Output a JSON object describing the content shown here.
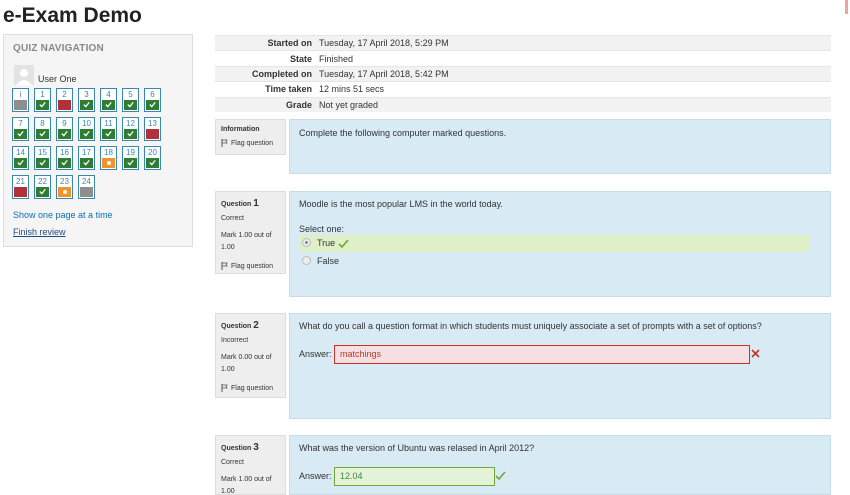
{
  "page": {
    "title": "e-Exam Demo"
  },
  "nav": {
    "heading": "QUIZ NAVIGATION",
    "user_name": "User One",
    "buttons": [
      {
        "label": "i",
        "state": "info"
      },
      {
        "label": "1",
        "state": "correct"
      },
      {
        "label": "2",
        "state": "incorrect"
      },
      {
        "label": "3",
        "state": "correct"
      },
      {
        "label": "4",
        "state": "correct"
      },
      {
        "label": "5",
        "state": "correct"
      },
      {
        "label": "6",
        "state": "correct"
      },
      {
        "label": "7",
        "state": "correct"
      },
      {
        "label": "8",
        "state": "correct"
      },
      {
        "label": "9",
        "state": "correct"
      },
      {
        "label": "10",
        "state": "correct"
      },
      {
        "label": "11",
        "state": "correct"
      },
      {
        "label": "12",
        "state": "correct"
      },
      {
        "label": "13",
        "state": "incorrect"
      },
      {
        "label": "14",
        "state": "correct"
      },
      {
        "label": "15",
        "state": "correct"
      },
      {
        "label": "16",
        "state": "correct"
      },
      {
        "label": "17",
        "state": "correct"
      },
      {
        "label": "18",
        "state": "partial"
      },
      {
        "label": "19",
        "state": "correct"
      },
      {
        "label": "20",
        "state": "correct"
      },
      {
        "label": "21",
        "state": "incorrect"
      },
      {
        "label": "22",
        "state": "correct"
      },
      {
        "label": "23",
        "state": "partial"
      },
      {
        "label": "24",
        "state": "nograde"
      }
    ],
    "show_one_page": "Show one page at a time",
    "finish_review": "Finish review"
  },
  "summary": {
    "rows": [
      {
        "key": "Started on",
        "value": "Tuesday, 17 April 2018, 5:29 PM"
      },
      {
        "key": "State",
        "value": "Finished"
      },
      {
        "key": "Completed on",
        "value": "Tuesday, 17 April 2018, 5:42 PM"
      },
      {
        "key": "Time taken",
        "value": "12 mins 51 secs"
      },
      {
        "key": "Grade",
        "value": "Not yet graded"
      }
    ]
  },
  "questions": {
    "info": {
      "title": "Information",
      "flag": "Flag question",
      "text": "Complete the following computer marked questions."
    },
    "q1": {
      "prefix": "Question",
      "num": "1",
      "status": "Correct",
      "mark_line1": "Mark 1.00 out of",
      "mark_line2": "1.00",
      "flag": "Flag question",
      "text": "Moodle is the most popular LMS in the world today.",
      "select_one": "Select one:",
      "options": [
        {
          "label": "True",
          "selected": true
        },
        {
          "label": "False",
          "selected": false
        }
      ]
    },
    "q2": {
      "prefix": "Question",
      "num": "2",
      "status": "Incorrect",
      "mark_line1": "Mark 0.00 out of",
      "mark_line2": "1.00",
      "flag": "Flag question",
      "text": "What do you call a question format in which students must uniquely associate a set of prompts with a set of options?",
      "answer_label": "Answer:",
      "answer_value": "matchings"
    },
    "q3": {
      "prefix": "Question",
      "num": "3",
      "status": "Correct",
      "mark_line1": "Mark 1.00 out of",
      "mark_line2": "1.00",
      "text": "What was the version of Ubuntu was relased in April 2012?",
      "answer_label": "Answer:",
      "answer_value": "12.04"
    }
  },
  "colors": {
    "correct": "#2e7d32",
    "incorrect": "#b0313a",
    "partial": "#f0932b",
    "info": "#8e8e8e",
    "question_bg": "#d8eaf4",
    "link": "#0b6fb0"
  }
}
